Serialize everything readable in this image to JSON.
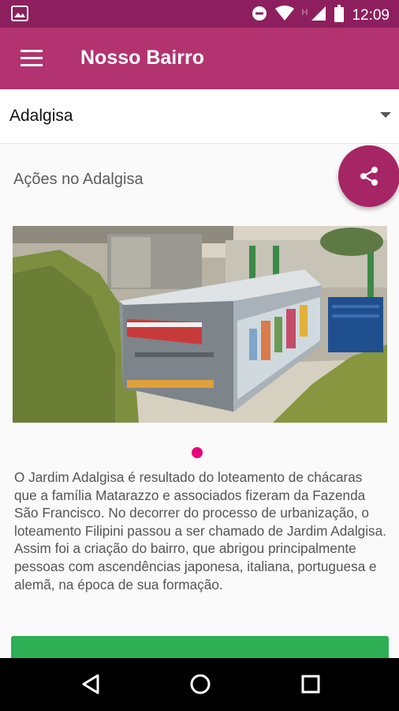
{
  "status_bar": {
    "time": "12:09",
    "network_letter": "H",
    "icons": [
      "image-icon",
      "do-not-disturb-icon",
      "wifi-icon",
      "signal-icon",
      "battery-icon"
    ]
  },
  "app_bar": {
    "title": "Nosso Bairro",
    "menu_icon": "hamburger-menu-icon"
  },
  "neighborhood_selector": {
    "selected": "Adalgisa"
  },
  "share_fab": {
    "icon": "share-icon",
    "color": "#a52565"
  },
  "section": {
    "title": "Ações no Adalgisa"
  },
  "carousel": {
    "image": "photo of a large grey waste container truck installed on a concrete base",
    "active_index": 0,
    "indicator_color": "#e6007e"
  },
  "description": "O Jardim Adalgisa é resultado do loteamento de chácaras que a família Matarazzo e associados fizeram da Fazenda São Francisco. No decorrer do processo de urbanização, o loteamento Filipini passou a ser chamado de Jardim Adalgisa. Assim foi a criação do bairro, que abrigou principalmente pessoas com ascendências japonesa, italiana, portuguesa e alemã, na época de sua formação.",
  "action_button": {
    "color": "#2eaf55"
  },
  "nav_bar": {
    "icons": [
      "back-icon",
      "home-icon",
      "recents-icon"
    ]
  },
  "colors": {
    "status_bar": "#8e1f5e",
    "app_bar": "#b2336f",
    "accent": "#e6007e",
    "button": "#2eaf55"
  }
}
